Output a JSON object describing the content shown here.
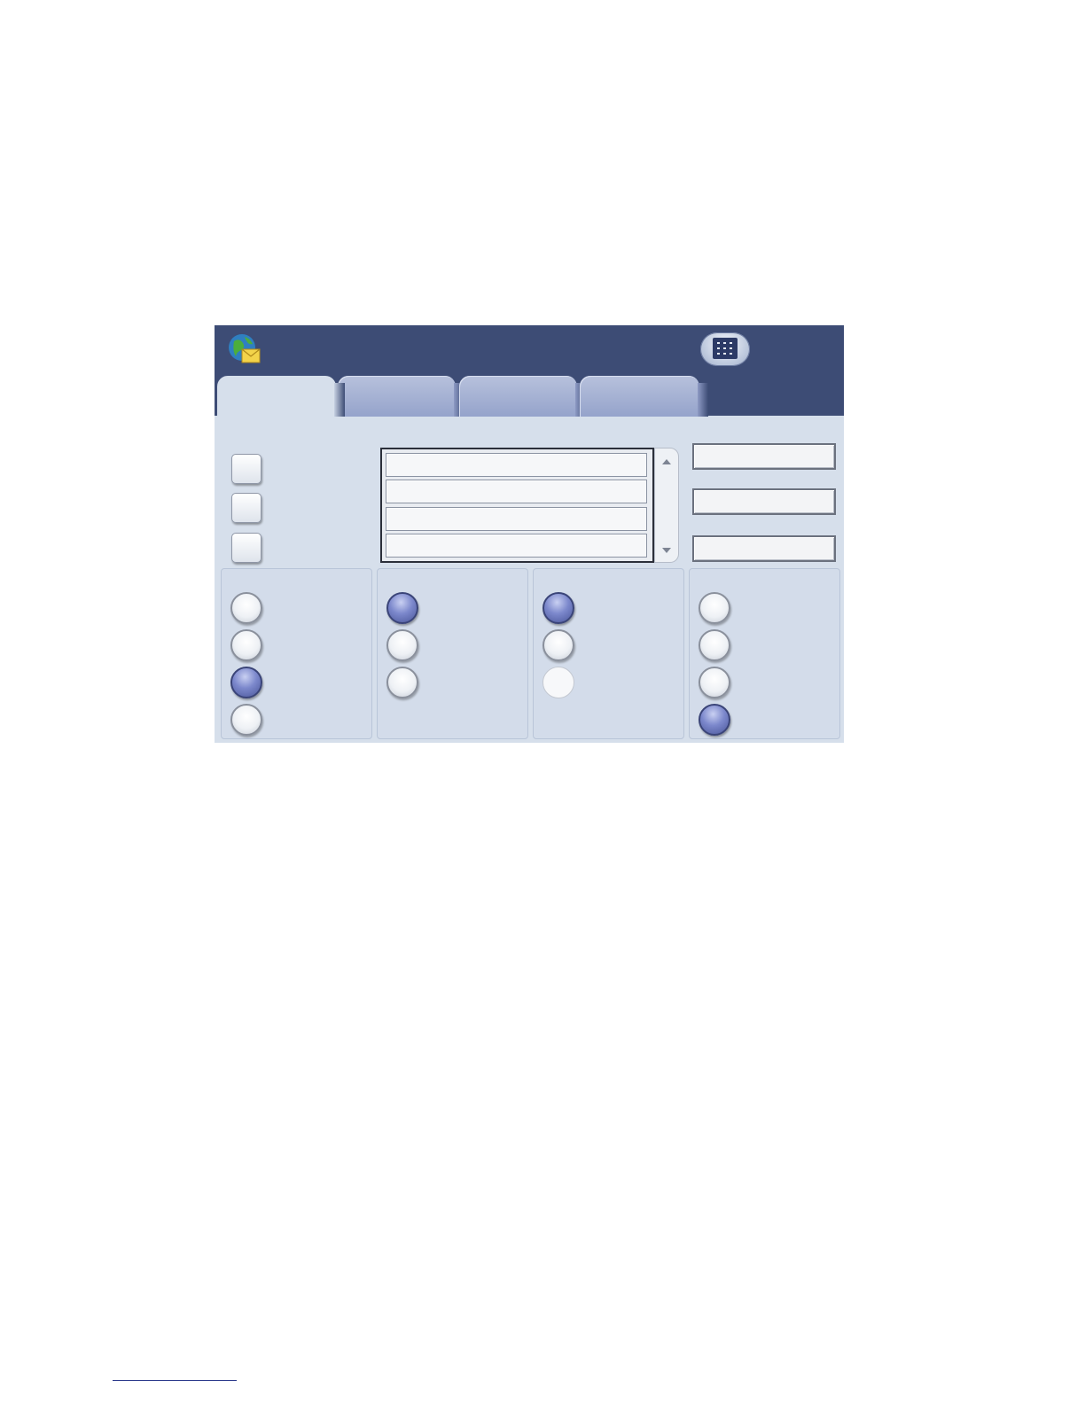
{
  "app": {
    "icon": "globe-email-icon"
  },
  "header": {
    "keypad_icon": "keypad-icon"
  },
  "tabs": [
    {
      "label": "",
      "active": true
    },
    {
      "label": "",
      "active": false
    },
    {
      "label": "",
      "active": false
    },
    {
      "label": "",
      "active": false
    }
  ],
  "checkboxes": [
    {
      "label": "",
      "checked": false
    },
    {
      "label": "",
      "checked": false
    },
    {
      "label": "",
      "checked": false
    }
  ],
  "list": {
    "rows": [
      "",
      "",
      "",
      ""
    ]
  },
  "side_buttons": [
    "",
    "",
    ""
  ],
  "panels": [
    {
      "options": [
        {
          "label": "",
          "selected": false
        },
        {
          "label": "",
          "selected": false
        },
        {
          "label": "",
          "selected": true
        },
        {
          "label": "",
          "selected": false
        }
      ]
    },
    {
      "options": [
        {
          "label": "",
          "selected": true
        },
        {
          "label": "",
          "selected": false
        },
        {
          "label": "",
          "selected": false
        }
      ]
    },
    {
      "options": [
        {
          "label": "",
          "selected": true
        },
        {
          "label": "",
          "selected": false
        },
        {
          "label": "",
          "selected": false,
          "disabled": true
        }
      ]
    },
    {
      "options": [
        {
          "label": "",
          "selected": false
        },
        {
          "label": "",
          "selected": false
        },
        {
          "label": "",
          "selected": false
        },
        {
          "label": "",
          "selected": true
        }
      ]
    }
  ],
  "colors": {
    "header": "#3d4c75",
    "body": "#d6dfeb",
    "tab": "#9fabd0",
    "selected_radio": "#5b67b0"
  }
}
